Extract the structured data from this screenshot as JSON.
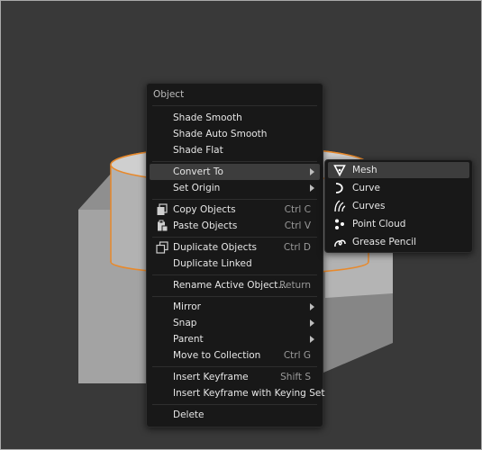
{
  "context_menu": {
    "title": "Object",
    "items": [
      {
        "label": "Shade Smooth"
      },
      {
        "label": "Shade Auto Smooth"
      },
      {
        "label": "Shade Flat"
      },
      {
        "label": "Convert To"
      },
      {
        "label": "Set Origin"
      },
      {
        "label": "Copy Objects",
        "shortcut": "Ctrl C",
        "icon": "copy-icon"
      },
      {
        "label": "Paste Objects",
        "shortcut": "Ctrl V",
        "icon": "paste-icon"
      },
      {
        "label": "Duplicate Objects",
        "shortcut": "Ctrl D",
        "icon": "duplicate-icon"
      },
      {
        "label": "Duplicate Linked"
      },
      {
        "label": "Rename Active Object...",
        "shortcut": "Return"
      },
      {
        "label": "Mirror"
      },
      {
        "label": "Snap"
      },
      {
        "label": "Parent"
      },
      {
        "label": "Move to Collection",
        "shortcut": "Ctrl G"
      },
      {
        "label": "Insert Keyframe",
        "shortcut": "Shift S"
      },
      {
        "label": "Insert Keyframe with Keying Set"
      },
      {
        "label": "Delete"
      }
    ]
  },
  "convert_submenu": {
    "items": [
      {
        "label": "Mesh",
        "icon": "mesh-icon"
      },
      {
        "label": "Curve",
        "icon": "curve-icon"
      },
      {
        "label": "Curves",
        "icon": "curves-icon"
      },
      {
        "label": "Point Cloud",
        "icon": "point-cloud-icon"
      },
      {
        "label": "Grease Pencil",
        "icon": "grease-pencil-icon"
      }
    ]
  },
  "colors": {
    "viewport_bg": "#393939",
    "menu_bg": "#181818",
    "highlight": "#3d3d3d",
    "selection_outline": "#e8892b"
  }
}
